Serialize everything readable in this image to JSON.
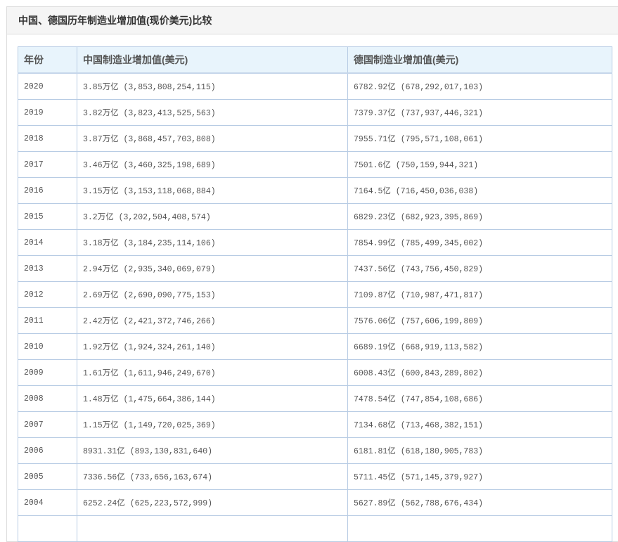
{
  "panel": {
    "title": "中国、德国历年制造业增加值(现价美元)比较"
  },
  "table": {
    "headers": [
      "年份",
      "中国制造业增加值(美元)",
      "德国制造业增加值(美元)"
    ],
    "rows": [
      {
        "year": "2020",
        "china": "3.85万亿 (3,853,808,254,115)",
        "germany": "6782.92亿 (678,292,017,103)"
      },
      {
        "year": "2019",
        "china": "3.82万亿 (3,823,413,525,563)",
        "germany": "7379.37亿 (737,937,446,321)"
      },
      {
        "year": "2018",
        "china": "3.87万亿 (3,868,457,703,808)",
        "germany": "7955.71亿 (795,571,108,061)"
      },
      {
        "year": "2017",
        "china": "3.46万亿 (3,460,325,198,689)",
        "germany": "7501.6亿 (750,159,944,321)"
      },
      {
        "year": "2016",
        "china": "3.15万亿 (3,153,118,068,884)",
        "germany": "7164.5亿 (716,450,036,038)"
      },
      {
        "year": "2015",
        "china": "3.2万亿 (3,202,504,408,574)",
        "germany": "6829.23亿 (682,923,395,869)"
      },
      {
        "year": "2014",
        "china": "3.18万亿 (3,184,235,114,106)",
        "germany": "7854.99亿 (785,499,345,002)"
      },
      {
        "year": "2013",
        "china": "2.94万亿 (2,935,340,069,079)",
        "germany": "7437.56亿 (743,756,450,829)"
      },
      {
        "year": "2012",
        "china": "2.69万亿 (2,690,090,775,153)",
        "germany": "7109.87亿 (710,987,471,817)"
      },
      {
        "year": "2011",
        "china": "2.42万亿 (2,421,372,746,266)",
        "germany": "7576.06亿 (757,606,199,809)"
      },
      {
        "year": "2010",
        "china": "1.92万亿 (1,924,324,261,140)",
        "germany": "6689.19亿 (668,919,113,582)"
      },
      {
        "year": "2009",
        "china": "1.61万亿 (1,611,946,249,670)",
        "germany": "6008.43亿 (600,843,289,802)"
      },
      {
        "year": "2008",
        "china": "1.48万亿 (1,475,664,386,144)",
        "germany": "7478.54亿 (747,854,108,686)"
      },
      {
        "year": "2007",
        "china": "1.15万亿 (1,149,720,025,369)",
        "germany": "7134.68亿 (713,468,382,151)"
      },
      {
        "year": "2006",
        "china": "8931.31亿 (893,130,831,640)",
        "germany": "6181.81亿 (618,180,905,783)"
      },
      {
        "year": "2005",
        "china": "7336.56亿 (733,656,163,674)",
        "germany": "5711.45亿 (571,145,379,927)"
      },
      {
        "year": "2004",
        "china": "6252.24亿 (625,223,572,999)",
        "germany": "5627.89亿 (562,788,676,434)"
      }
    ]
  }
}
